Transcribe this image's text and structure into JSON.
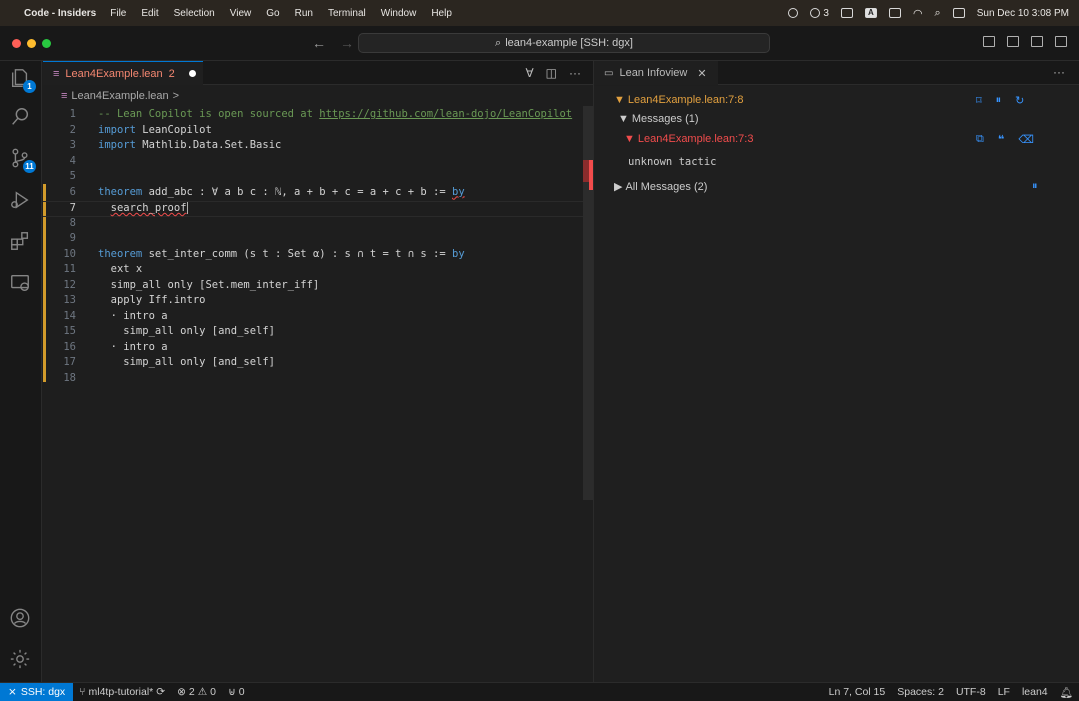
{
  "menubar": {
    "app_name": "Code - Insiders",
    "items": [
      "File",
      "Edit",
      "Selection",
      "View",
      "Go",
      "Run",
      "Terminal",
      "Window",
      "Help"
    ],
    "wechat_count": "3",
    "clock": "Sun Dec 10  3:08 PM"
  },
  "titlebar": {
    "command_center": "lean4-example [SSH: dgx]"
  },
  "activity": {
    "explorer_badge": "1",
    "scm_badge": "11"
  },
  "editor": {
    "tab_label": "Lean4Example.lean",
    "tab_problems": "2",
    "breadcrumb_file": "Lean4Example.lean",
    "breadcrumb_sep": ">",
    "lines": [
      {
        "n": "1",
        "parts": [
          {
            "t": "-- Lean Copilot is open sourced at ",
            "c": "cm"
          },
          {
            "t": "https://github.com/lean-dojo/LeanCopilot",
            "c": "lnk"
          }
        ]
      },
      {
        "n": "2",
        "parts": [
          {
            "t": "import",
            "c": "kw"
          },
          {
            "t": " LeanCopilot",
            "c": ""
          }
        ]
      },
      {
        "n": "3",
        "parts": [
          {
            "t": "import",
            "c": "kw"
          },
          {
            "t": " Mathlib.Data.Set.Basic",
            "c": ""
          }
        ]
      },
      {
        "n": "4",
        "parts": []
      },
      {
        "n": "5",
        "parts": []
      },
      {
        "n": "6",
        "parts": [
          {
            "t": "theorem",
            "c": "kw"
          },
          {
            "t": " add_abc : ∀ a b c : ℕ, a + b + c = a + c + b := ",
            "c": ""
          },
          {
            "t": "by",
            "c": "kw err"
          }
        ]
      },
      {
        "n": "7",
        "parts": [
          {
            "t": "  ",
            "c": ""
          },
          {
            "t": "search_proof",
            "c": "err"
          }
        ],
        "cursor": true,
        "current": true
      },
      {
        "n": "8",
        "parts": []
      },
      {
        "n": "9",
        "parts": []
      },
      {
        "n": "10",
        "parts": [
          {
            "t": "theorem",
            "c": "kw"
          },
          {
            "t": " set_inter_comm (s t : Set α) : s ∩ t = t ∩ s := ",
            "c": ""
          },
          {
            "t": "by",
            "c": "kw"
          }
        ]
      },
      {
        "n": "11",
        "parts": [
          {
            "t": "  ext x",
            "c": ""
          }
        ]
      },
      {
        "n": "12",
        "parts": [
          {
            "t": "  simp_all only [Set.mem_inter_iff]",
            "c": ""
          }
        ]
      },
      {
        "n": "13",
        "parts": [
          {
            "t": "  apply Iff.intro",
            "c": ""
          }
        ]
      },
      {
        "n": "14",
        "parts": [
          {
            "t": "  · intro a",
            "c": ""
          }
        ]
      },
      {
        "n": "15",
        "parts": [
          {
            "t": "    simp_all only [and_self]",
            "c": ""
          }
        ]
      },
      {
        "n": "16",
        "parts": [
          {
            "t": "  · intro a",
            "c": ""
          }
        ]
      },
      {
        "n": "17",
        "parts": [
          {
            "t": "    simp_all only [and_self]",
            "c": ""
          }
        ]
      },
      {
        "n": "18",
        "parts": []
      }
    ]
  },
  "infoview": {
    "tab_label": "Lean Infoview",
    "location": "Lean4Example.lean:7:8",
    "messages_header": "Messages (1)",
    "message_location": "Lean4Example.lean:7:3",
    "message_text": "unknown tactic",
    "all_messages": "All Messages (2)"
  },
  "statusbar": {
    "remote": "SSH: dgx",
    "branch": "ml4tp-tutorial*",
    "errors": "2",
    "warnings": "0",
    "ports": "0",
    "position": "Ln 7, Col 15",
    "spaces": "Spaces: 2",
    "encoding": "UTF-8",
    "eol": "LF",
    "language": "lean4"
  },
  "colors": {
    "accent": "#0078d4",
    "error": "#f14c4c",
    "warning_orange": "#e2a03f",
    "keyword": "#569cd6"
  }
}
